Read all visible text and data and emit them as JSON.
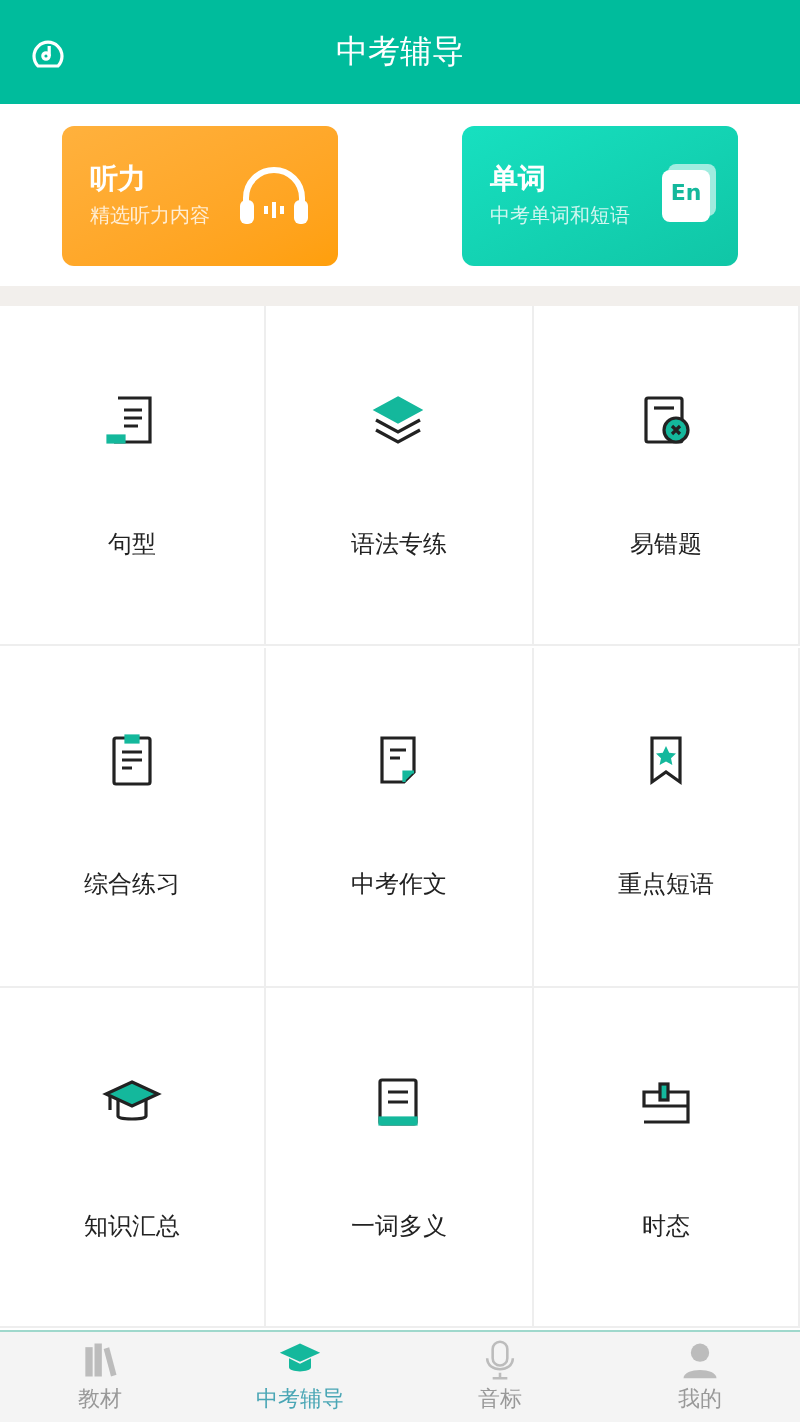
{
  "header": {
    "title": "中考辅导"
  },
  "cards": [
    {
      "title": "听力",
      "subtitle": "精选听力内容",
      "kind": "listening"
    },
    {
      "title": "单词",
      "subtitle": "中考单词和短语",
      "kind": "words",
      "badge": "En"
    }
  ],
  "grid": [
    {
      "label": "句型"
    },
    {
      "label": "语法专练"
    },
    {
      "label": "易错题"
    },
    {
      "label": "综合练习"
    },
    {
      "label": "中考作文"
    },
    {
      "label": "重点短语"
    },
    {
      "label": "知识汇总"
    },
    {
      "label": "一词多义"
    },
    {
      "label": "时态"
    }
  ],
  "tabs": [
    {
      "label": "教材",
      "selected": false
    },
    {
      "label": "中考辅导",
      "selected": true
    },
    {
      "label": "音标",
      "selected": false
    },
    {
      "label": "我的",
      "selected": false
    }
  ]
}
